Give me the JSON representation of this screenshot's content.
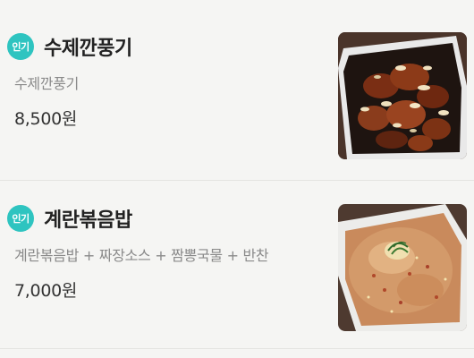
{
  "menu": {
    "items": [
      {
        "badge": "인기",
        "name": "수제깐풍기",
        "description": "수제깐풍기",
        "price": "8,500원"
      },
      {
        "badge": "인기",
        "name": "계란볶음밥",
        "description": "계란볶음밥 + 짜장소스 + 짬뽕국물 + 반찬",
        "price": "7,000원"
      }
    ]
  },
  "colors": {
    "badge": "#2ec4c0",
    "background": "#f5f5f3",
    "name_text": "#222222",
    "description_text": "#8a8a8a"
  }
}
